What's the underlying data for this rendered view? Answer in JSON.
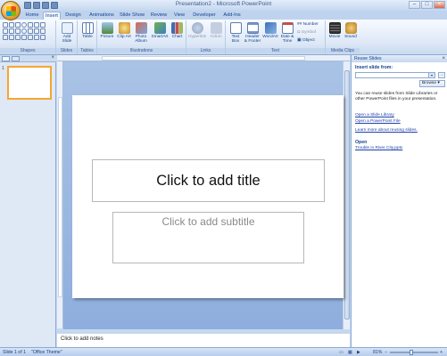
{
  "window": {
    "title": "Presentation2 - Microsoft PowerPoint",
    "controls": [
      "–",
      "□",
      "×"
    ]
  },
  "tabs": [
    "Home",
    "Insert",
    "Design",
    "Animations",
    "Slide Show",
    "Review",
    "View",
    "Developer",
    "Add-Ins"
  ],
  "active_tab": "Insert",
  "ribbon": {
    "groups": {
      "shapes": "Shapes",
      "slides": "Slides",
      "tables": "Tables",
      "illustrations": "Illustrations",
      "links": "Links",
      "text": "Text",
      "media": "Media Clips"
    },
    "buttons": {
      "add_slide": "Add Slide",
      "table": "Table",
      "picture": "Picture",
      "clip_art": "Clip Art",
      "photo_album": "Photo Album",
      "smartart": "SmartArt",
      "chart": "Chart",
      "hyperlink": "Hyperlink",
      "action": "Action",
      "text_box": "Text Box",
      "header_footer": "Header & Footer",
      "wordart": "WordArt",
      "date_time": "Date & Time",
      "slide_number": "Number",
      "symbol": "Symbol",
      "object": "Object",
      "movie": "Movie",
      "sound": "Sound"
    }
  },
  "thumbnail": {
    "number": "1"
  },
  "slide": {
    "title_placeholder": "Click to add title",
    "subtitle_placeholder": "Click to add subtitle"
  },
  "notes": {
    "placeholder": "Click to add notes"
  },
  "reuse_pane": {
    "header": "Reuse Slides",
    "insert_from_label": "Insert slide from:",
    "browse_label": "Browse ▾",
    "description": "You can reuse slides from Slide Libraries or other PowerPoint files in your presentation.",
    "link_library": "Open a Slide Library",
    "link_file": "Open a PowerPoint File",
    "link_learn": "Learn more about reusing slides.",
    "open_heading": "Open",
    "recent_file": "Trouble in River City.pptx"
  },
  "status": {
    "slide": "Slide 1 of 1",
    "theme": "\"Office Theme\"",
    "zoom": "81%"
  },
  "colors": {
    "accent_orange": "#f6a633",
    "ribbon_blue": "#dce7f6",
    "canvas_blue": "#9bb7e1"
  }
}
